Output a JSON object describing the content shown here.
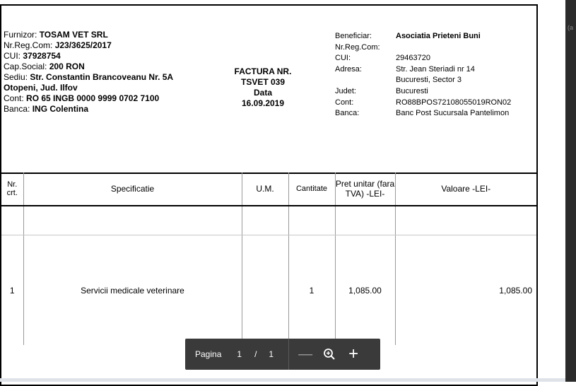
{
  "supplier": {
    "furnizor_label": "Furnizor:",
    "furnizor": "TOSAM VET SRL",
    "nrreg_label": "Nr.Reg.Com:",
    "nrreg": "J23/3625/2017",
    "cui_label": "CUI:",
    "cui": "37928754",
    "capsoc_label": "Cap.Social:",
    "capsoc": "200 RON",
    "sediu_label": "Sediu:",
    "sediu": "Str. Constantin Brancoveanu Nr. 5A",
    "localitate": "Otopeni, Jud. Ilfov",
    "cont_label": "Cont:",
    "cont": "RO 65 INGB 0000 9999 0702 7100",
    "banca_label": "Banca:",
    "banca": "ING Colentina"
  },
  "invoice": {
    "title": "FACTURA NR.",
    "number": "TSVET 039",
    "data_label": "Data",
    "date": "16.09.2019"
  },
  "client": {
    "beneficiar_label": "Beneficiar:",
    "beneficiar": "Asociatia Prieteni Buni",
    "nrreg_label": "Nr.Reg.Com:",
    "cui_label": "CUI:",
    "cui": "29463720",
    "adresa_label": "Adresa:",
    "adresa1": "Str. Jean Steriadi nr 14",
    "adresa2": "Bucuresti, Sector 3",
    "judet_label": "Judet:",
    "judet": "Bucuresti",
    "cont_label": "Cont:",
    "cont": "RO88BPOS72108055019RON02",
    "banca_label": "Banca:",
    "banca": "Banc Post Sucursala Pantelimon"
  },
  "table": {
    "headers": {
      "nr": "Nr. crt.",
      "spec": "Specificatie",
      "um": "U.M.",
      "cant": "Cantitate",
      "pret": "Pret unitar (fara TVA) -LEI-",
      "valoare": "Valoare -LEI-"
    },
    "rows": [
      {
        "nr": "1",
        "spec": "Servicii medicale veterinare",
        "um": "",
        "cant": "1",
        "pret": "1,085.00",
        "valoare": "1,085.00"
      }
    ]
  },
  "pager": {
    "label": "Pagina",
    "current": "1",
    "separator": "/",
    "total": "1",
    "zoom_out": "—",
    "zoom_in": "+"
  },
  "side": {
    "fragment": "(a"
  },
  "icons": {
    "zoom_out": "minus-icon",
    "fit": "zoom-fit-icon",
    "zoom_in": "plus-icon"
  }
}
